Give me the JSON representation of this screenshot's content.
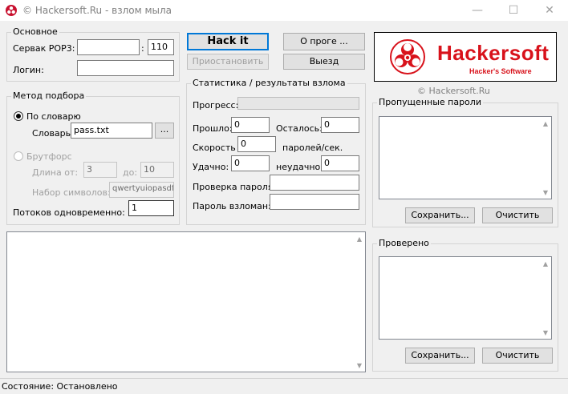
{
  "window": {
    "title": "© Hackersoft.Ru - взлом мыла",
    "minimize_glyph": "—",
    "maximize_glyph": "☐",
    "close_glyph": "✕"
  },
  "basic": {
    "label": "Основное",
    "server_label": "Сервак POP3:",
    "server_value": "",
    "port_sep": ":",
    "port_value": "110",
    "login_label": "Логин:",
    "login_value": ""
  },
  "buttons": {
    "hack": "Hack it",
    "pause": "Приостановить",
    "about": "О проге ...",
    "exit": "Выезд"
  },
  "logo": {
    "brand": "Hackersoft",
    "tagline": "Hacker's Software",
    "copyright": "© Hackersoft.Ru",
    "color": "#d8121b"
  },
  "method": {
    "label": "Метод подбора",
    "dict_label": "По словарю",
    "dict_file_label": "Словарь:",
    "dict_file_value": "pass.txt",
    "browse_label": "...",
    "brute_label": "Брутфорс",
    "len_from_label": "Длина от:",
    "len_from_value": "3",
    "len_to_label": "до:",
    "len_to_value": "10",
    "charset_label": "Набор символов:",
    "charset_value": "qwertyuiopasdfg",
    "threads_label": "Потоков одновременно:",
    "threads_value": "1"
  },
  "stats": {
    "label": "Статистика / результаты взлома",
    "progress_label": "Прогресс:",
    "progress_fraction": 0,
    "elapsed_label": "Прошло:",
    "elapsed_value": "0",
    "remaining_label": "Осталось:",
    "remaining_value": "0",
    "speed_label": "Скорость",
    "speed_value": "0",
    "speed_unit": "паролей/сек.",
    "success_label": "Удачно:",
    "success_value": "0",
    "fail_label": "неудачно:",
    "fail_value": "0",
    "check_label": "Проверка пароля:",
    "check_value": "",
    "cracked_label": "Пароль взломан:",
    "cracked_value": ""
  },
  "skipped": {
    "label": "Пропущенные пароли",
    "save_label": "Сохранить...",
    "clear_label": "Очистить"
  },
  "checked": {
    "label": "Проверено",
    "save_label": "Сохранить...",
    "clear_label": "Очистить"
  },
  "status": {
    "text": "Состояние: Остановлено"
  }
}
